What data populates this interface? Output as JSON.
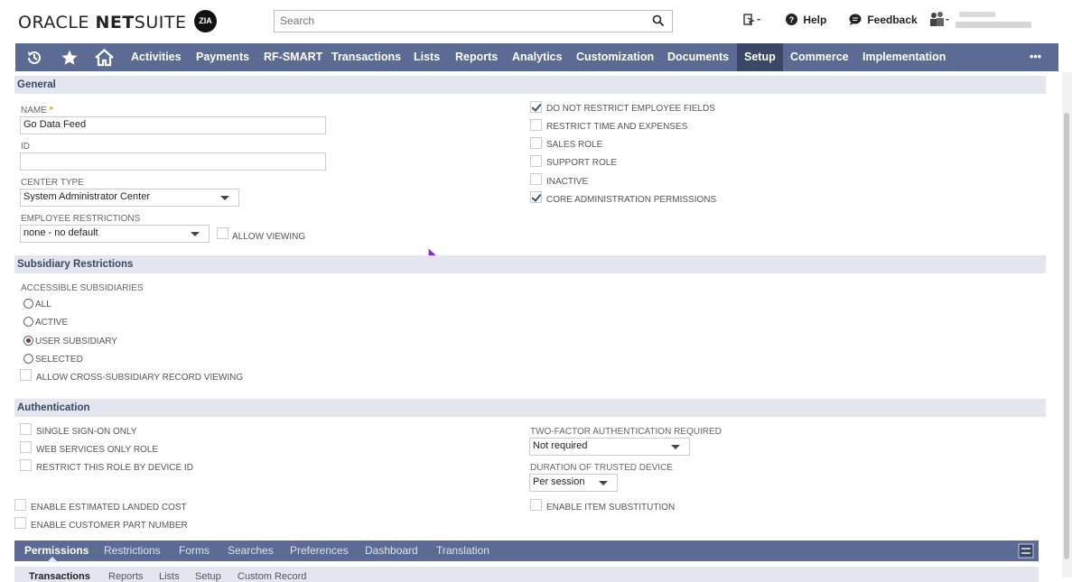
{
  "header": {
    "brand_part1": "ORACLE ",
    "brand_part2": "NET",
    "brand_part3": "SUITE",
    "zia_label": "ZIA",
    "search_placeholder": "Search",
    "help_label": "Help",
    "feedback_label": "Feedback"
  },
  "nav": {
    "items": [
      "Activities",
      "Payments",
      "RF-SMART",
      "Transactions",
      "Lists",
      "Reports",
      "Analytics",
      "Customization",
      "Documents",
      "Setup",
      "Commerce",
      "Implementation"
    ],
    "active": "Setup",
    "more_label": "•••"
  },
  "general": {
    "section_title": "General",
    "name_label": "NAME",
    "name_value": "Go Data Feed",
    "id_label": "ID",
    "id_value": "",
    "center_type_label": "CENTER TYPE",
    "center_type_value": "System Administrator Center",
    "employee_restrictions_label": "EMPLOYEE RESTRICTIONS",
    "employee_restrictions_value": "none - no default",
    "allow_viewing_label": "ALLOW VIEWING",
    "right_checks": [
      {
        "label": "DO NOT RESTRICT EMPLOYEE FIELDS",
        "checked": true
      },
      {
        "label": "RESTRICT TIME AND EXPENSES",
        "checked": false
      },
      {
        "label": "SALES ROLE",
        "checked": false
      },
      {
        "label": "SUPPORT ROLE",
        "checked": false
      },
      {
        "label": "INACTIVE",
        "checked": false
      },
      {
        "label": "CORE ADMINISTRATION PERMISSIONS",
        "checked": true
      }
    ]
  },
  "subsidiary": {
    "section_title": "Subsidiary Restrictions",
    "accessible_label": "ACCESSIBLE SUBSIDIARIES",
    "options": [
      "ALL",
      "ACTIVE",
      "USER SUBSIDIARY",
      "SELECTED"
    ],
    "selected": "USER SUBSIDIARY",
    "cross_label": "ALLOW CROSS-SUBSIDIARY RECORD VIEWING"
  },
  "authentication": {
    "section_title": "Authentication",
    "sso_label": "SINGLE SIGN-ON ONLY",
    "web_services_label": "WEB SERVICES ONLY ROLE",
    "device_id_label": "RESTRICT THIS ROLE BY DEVICE ID",
    "two_factor_label": "TWO-FACTOR AUTHENTICATION REQUIRED",
    "two_factor_value": "Not required",
    "duration_label": "DURATION OF TRUSTED DEVICE",
    "duration_value": "Per session"
  },
  "extras": {
    "landed_cost_label": "ENABLE ESTIMATED LANDED COST",
    "part_number_label": "ENABLE CUSTOMER PART NUMBER",
    "item_substitution_label": "ENABLE ITEM SUBSTITUTION"
  },
  "tabs": {
    "items": [
      "Permissions",
      "Restrictions",
      "Forms",
      "Searches",
      "Preferences",
      "Dashboard",
      "Translation"
    ],
    "active": "Permissions"
  },
  "subtabs": {
    "items": [
      "Transactions",
      "Reports",
      "Lists",
      "Setup",
      "Custom Record"
    ],
    "active": "Transactions"
  }
}
